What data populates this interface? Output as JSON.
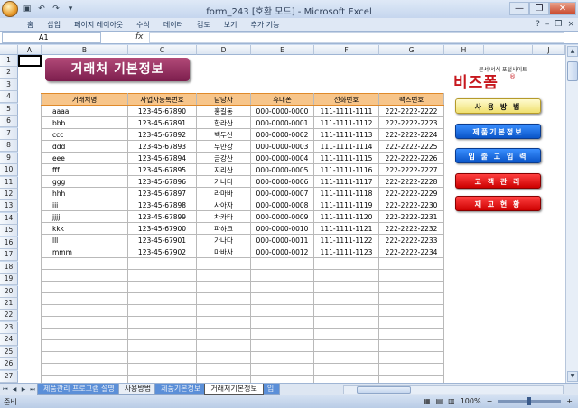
{
  "window": {
    "title": "form_243  [호환 모드] - Microsoft Excel",
    "controls": [
      "—",
      "❐",
      "✕"
    ]
  },
  "qat_icons": [
    "save-icon",
    "undo-icon",
    "redo-icon",
    "dropdown-icon"
  ],
  "ribbon": {
    "tabs": [
      "홈",
      "삽입",
      "페이지 레이아웃",
      "수식",
      "데이터",
      "검토",
      "보기",
      "추가 기능"
    ],
    "right_icons": [
      "help-icon",
      "minimize-ribbon-icon",
      "restore-icon",
      "close-icon"
    ]
  },
  "formula_bar": {
    "name_box": "A1",
    "fx_label": "fx",
    "value": ""
  },
  "columns": [
    "A",
    "B",
    "C",
    "D",
    "E",
    "F",
    "G",
    "H",
    "I",
    "J"
  ],
  "rows": [
    "1",
    "2",
    "3",
    "4",
    "5",
    "6",
    "7",
    "8",
    "9",
    "10",
    "11",
    "12",
    "13",
    "14",
    "15",
    "16",
    "17",
    "18",
    "19",
    "20",
    "21",
    "22",
    "23",
    "24",
    "25",
    "26",
    "27"
  ],
  "banner": {
    "title": "거래처 기본정보"
  },
  "table": {
    "headers": [
      "거래처명",
      "사업자등록번호",
      "담당자",
      "휴대폰",
      "전화번호",
      "팩스번호"
    ],
    "rows": [
      [
        "aaaa",
        "123-45-67890",
        "홍길동",
        "000-0000-0000",
        "111-1111-1111",
        "222-2222-2222"
      ],
      [
        "bbb",
        "123-45-67891",
        "한라산",
        "000-0000-0001",
        "111-1111-1112",
        "222-2222-2223"
      ],
      [
        "ccc",
        "123-45-67892",
        "백두산",
        "000-0000-0002",
        "111-1111-1113",
        "222-2222-2224"
      ],
      [
        "ddd",
        "123-45-67893",
        "두만강",
        "000-0000-0003",
        "111-1111-1114",
        "222-2222-2225"
      ],
      [
        "eee",
        "123-45-67894",
        "금강산",
        "000-0000-0004",
        "111-1111-1115",
        "222-2222-2226"
      ],
      [
        "fff",
        "123-45-67895",
        "지리산",
        "000-0000-0005",
        "111-1111-1116",
        "222-2222-2227"
      ],
      [
        "ggg",
        "123-45-67896",
        "가나다",
        "000-0000-0006",
        "111-1111-1117",
        "222-2222-2228"
      ],
      [
        "hhh",
        "123-45-67897",
        "라마바",
        "000-0000-0007",
        "111-1111-1118",
        "222-2222-2229"
      ],
      [
        "iii",
        "123-45-67898",
        "사아자",
        "000-0000-0008",
        "111-1111-1119",
        "222-2222-2230"
      ],
      [
        "jjjj",
        "123-45-67899",
        "차카타",
        "000-0000-0009",
        "111-1111-1120",
        "222-2222-2231"
      ],
      [
        "kkk",
        "123-45-67900",
        "파하크",
        "000-0000-0010",
        "111-1111-1121",
        "222-2222-2232"
      ],
      [
        "lll",
        "123-45-67901",
        "가나다",
        "000-0000-0011",
        "111-1111-1122",
        "222-2222-2233"
      ],
      [
        "mmm",
        "123-45-67902",
        "마바사",
        "000-0000-0012",
        "111-1111-1123",
        "222-2222-2234"
      ]
    ],
    "empty_rows": 14
  },
  "logo": {
    "subtitle": "문서/서식 포털사이트",
    "name": "비즈폼",
    "reg": "®"
  },
  "menu": [
    {
      "label": "사 용 방 법",
      "style": "yellow",
      "color": "#f0e070"
    },
    {
      "label": "제품기본정보",
      "style": "blue",
      "color": "#0a55c8"
    },
    {
      "label": "입 출 고 입 력",
      "style": "blue",
      "color": "#0a55c8"
    },
    {
      "label": "고 객 관 리",
      "style": "red",
      "color": "#cc0000"
    },
    {
      "label": "재 고 현 황",
      "style": "red",
      "color": "#cc0000"
    }
  ],
  "sheet_tabs": {
    "nav": [
      "⏮",
      "◀",
      "▶",
      "⏭"
    ],
    "tabs": [
      {
        "label": "제품관리 프로그램 설명",
        "style": "blue"
      },
      {
        "label": "사용방법",
        "style": "normal"
      },
      {
        "label": "제품기본정보",
        "style": "blue"
      },
      {
        "label": "거래처기본정보",
        "style": "active"
      },
      {
        "label": "입",
        "style": "blue"
      }
    ]
  },
  "status": {
    "ready": "준비",
    "zoom": "100%",
    "zoom_minus": "−",
    "zoom_plus": "+"
  }
}
